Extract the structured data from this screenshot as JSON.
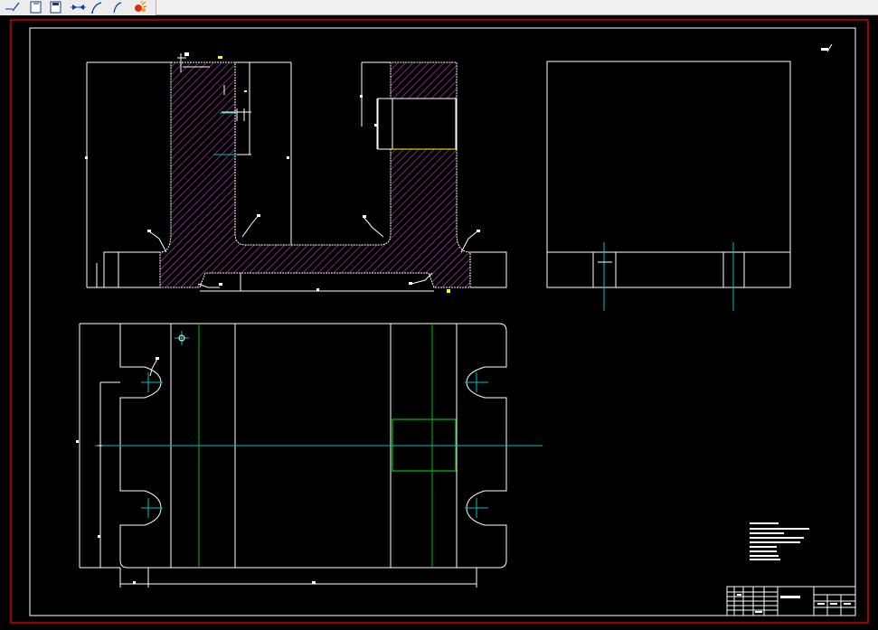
{
  "toolbar": {
    "tools": [
      {
        "name": "line-tool-icon"
      },
      {
        "name": "rectangle-tool-icon"
      },
      {
        "name": "block-tool-icon"
      },
      {
        "name": "dimension-tool-icon"
      },
      {
        "name": "arc-tool-icon"
      },
      {
        "name": "spline-tool-icon"
      },
      {
        "name": "explode-tool-icon"
      }
    ]
  },
  "drawing": {
    "background": "#000000",
    "border_color": "#ff0000",
    "line_color": "#ffffff",
    "hatch_color": "#c040c0",
    "centerline_color": "#00c0c0",
    "green_color": "#00c000",
    "yellow_color": "#ffff00"
  }
}
